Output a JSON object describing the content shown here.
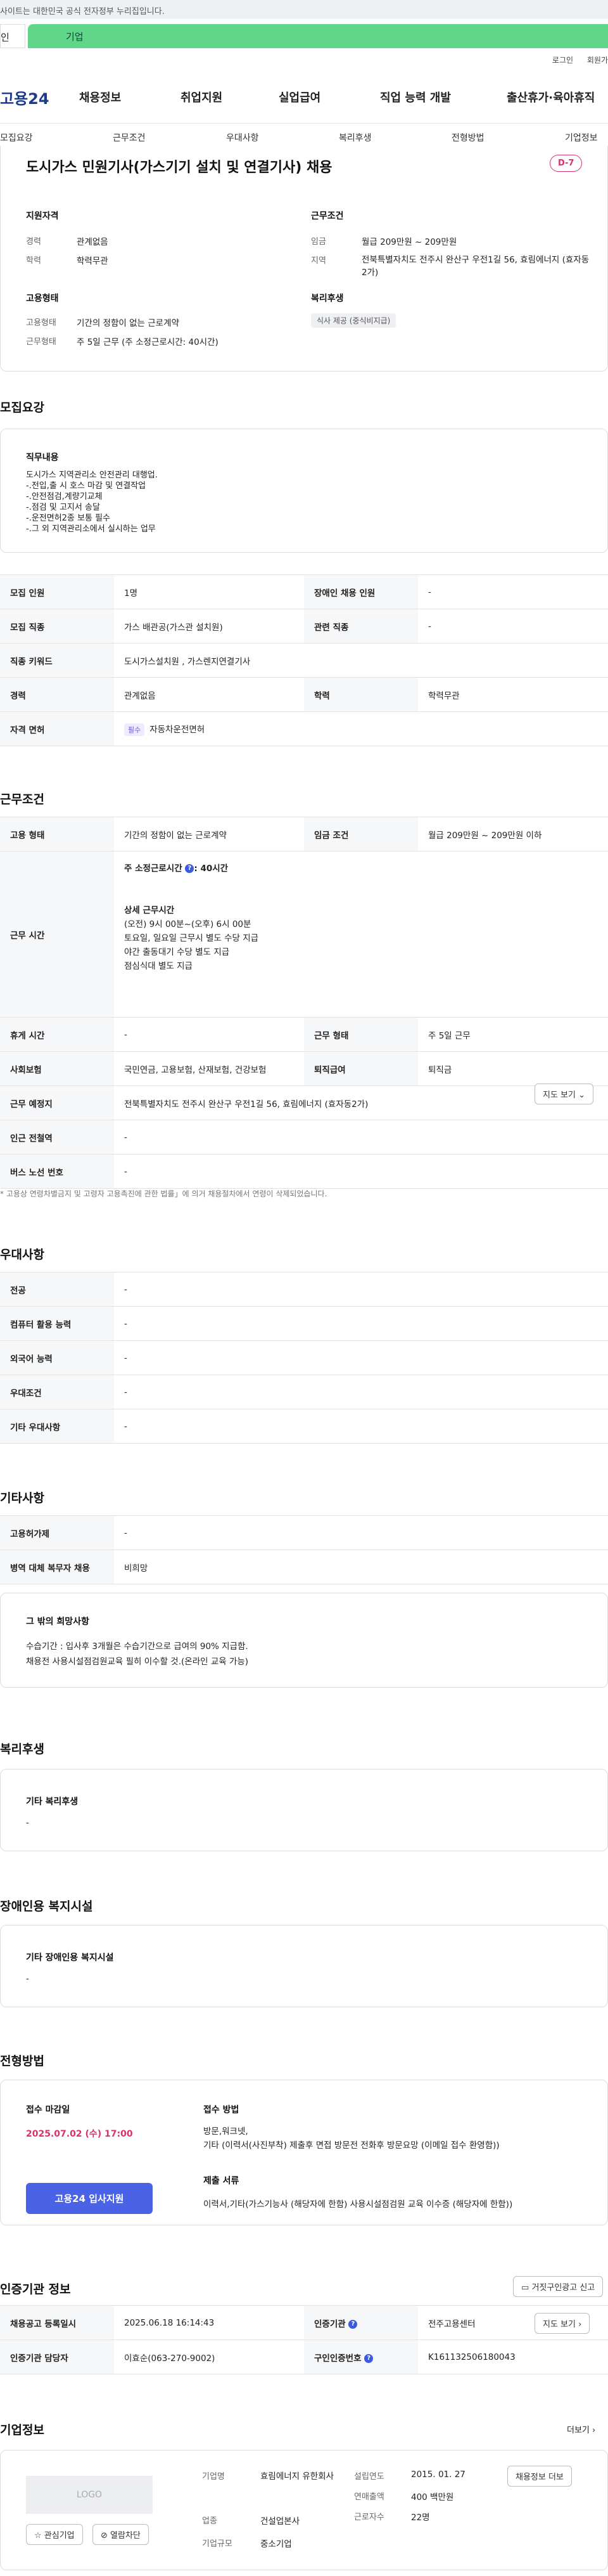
{
  "banner": {
    "text": "사이트는 대한민국 공식 전자정부 누리집입니다."
  },
  "topTabs": {
    "personal": "인",
    "company": "기업"
  },
  "util": {
    "login": "로그인",
    "join": "회원가"
  },
  "gnb": {
    "logo": "고용24",
    "menus": [
      "채용정보",
      "취업지원",
      "실업급여",
      "직업 능력 개발",
      "출산휴가·육아휴직"
    ]
  },
  "subnav": [
    "모집요강",
    "근무조건",
    "우대사항",
    "복리후생",
    "전형방법",
    "기업정보"
  ],
  "summary": {
    "title": "도시가스 민원기사(가스기기 설치 및 연결기사) 채용",
    "dday": "D-7",
    "qual_title": "지원자격",
    "career_label": "경력",
    "career_value": "관계없음",
    "edu_label": "학력",
    "edu_value": "학력무관",
    "cond_title": "근무조건",
    "wage_label": "임금",
    "wage_value": "월급 209만원 ~ 209만원",
    "region_label": "지역",
    "region_value": "전북특별자치도 전주시 완산구 우전1길 56, 효림에너지 (효자동2가)",
    "emp_title": "고용형태",
    "type_label": "고용형태",
    "type_value": "기간의 정함이 없는 근로계약",
    "work_label": "근무형태",
    "work_value": "주 5일 근무 (주 소정근로시간: 40시간)",
    "welfare_title": "복리후생",
    "welfare_badge": "식사 제공 (중식비지급)"
  },
  "recruit": {
    "title": "모집요강",
    "duty_title": "직무내용",
    "duty_lines": [
      "도시가스 지역관리소 안전관리 대행업.",
      "-.전입,출 시 호스 마감 및 연결작업",
      "-.안전점검,계량기교체",
      "-.점검 및 고지서 송달",
      "-.운전면허2종 보통 필수",
      "-.그 외 지역관리소에서 실시하는 업무"
    ],
    "rows": {
      "count_label": "모집 인원",
      "count_value": "1명",
      "disabled_label": "장애인 채용 인원",
      "disabled_value": "-",
      "job_label": "모집 직종",
      "job_value": "가스 배관공(가스관 설치원)",
      "related_label": "관련 직종",
      "related_value": "-",
      "kw_label": "직종 키워드",
      "kw_value": "도시가스설치원 , 가스렌지연결기사",
      "career_label": "경력",
      "career_value": "관계없음",
      "edu_label": "학력",
      "edu_value": "학력무관",
      "license_label": "자격 면허",
      "license_chip": "필수",
      "license_value": "자동차운전면허"
    }
  },
  "work": {
    "title": "근무조건",
    "type_label": "고용 형태",
    "type_value": "기간의 정함이 없는 근로계약",
    "wage_label": "임금 조건",
    "wage_value": "월급 209만원 ~ 209만원 이하",
    "hours_label": "근무 시간",
    "hours_main": "주 소정근로시간",
    "hours_main_value": ": 40시간",
    "hours_detail_title": "상세 근무시간",
    "hours_lines": [
      "(오전) 9시 00분~(오후) 6시 00분",
      "토요일, 일요일 근무시 별도 수당 지급",
      "야간 출동대기 수당 별도 지급",
      "점심식대 별도 지급"
    ],
    "rest_label": "휴게 시간",
    "rest_value": "-",
    "form_label": "근무 형태",
    "form_value": "주 5일 근무",
    "ins_label": "사회보험",
    "ins_value": "국민연금, 고용보험, 산재보험, 건강보험",
    "retire_label": "퇴직급여",
    "retire_value": "퇴직금",
    "place_label": "근무 예정지",
    "place_value": "전북특별자치도 전주시 완산구 우전1길 56, 효림에너지 (효자동2가)",
    "map_btn": "지도 보기",
    "station_label": "인근 전철역",
    "station_value": "-",
    "bus_label": "버스 노선 번호",
    "bus_value": "-",
    "note": "* 고용상 연령차별금지 및 고령자 고용촉진에 관한 법률」에 의거 채용절차에서 연령이 삭제되었습니다."
  },
  "pref": {
    "title": "우대사항",
    "major_label": "전공",
    "major_value": "-",
    "pc_label": "컴퓨터 활용 능력",
    "pc_value": "-",
    "lang_label": "외국어 능력",
    "lang_value": "-",
    "cond_label": "우대조건",
    "cond_value": "-",
    "etc_label": "기타 우대사항",
    "etc_value": "-"
  },
  "etc": {
    "title": "기타사항",
    "emp_label": "고용허가제",
    "emp_value": "-",
    "mil_label": "병역 대체 복무자 채용",
    "mil_value": "비희망",
    "hope_title": "그 밖의 희망사항",
    "hope_lines": [
      "수습기간 : 입사후 3개월은 수습기간으로 급여의 90% 지급함.",
      "채용전 사용시설점검원교육 필히 이수할 것.(온라인 교육 가능)"
    ]
  },
  "welfare": {
    "title": "복리후생",
    "sub": "기타 복리후생",
    "value": "-"
  },
  "disability": {
    "title": "장애인용 복지시설",
    "sub": "기타 장애인용 복지시설",
    "value": "-"
  },
  "process": {
    "title": "전형방법",
    "deadline_label": "접수 마감일",
    "deadline_value": "2025.07.02 (수) 17:00",
    "apply_btn": "고용24 입사지원",
    "method_label": "접수 방법",
    "method_lines": [
      "방문,워크넷,",
      "기타 (이력서(사진부착) 제출후 면접 방문전 전화후 방문요망 (이메일 접수 환영함))"
    ],
    "docs_label": "제출 서류",
    "docs_value": "이력서,기타(가스기능사 (해당자에 한함) 사용시설점검원 교육 이수증 (해당자에 한함))"
  },
  "agency": {
    "title": "인증기관 정보",
    "report_btn": "거짓구인광고 신고",
    "reg_label": "채용공고 등록일시",
    "reg_value": "2025.06.18 16:14:43",
    "org_label": "인증기관",
    "org_value": "전주고용센터",
    "map_btn": "지도 보기",
    "mgr_label": "인증기관 담당자",
    "mgr_value": "이효순(063-270-9002)",
    "no_label": "구인인증번호",
    "no_value": "K161132506180043"
  },
  "company": {
    "title": "기업정보",
    "more": "더보기",
    "logo_text": "LOGO",
    "fav_btn": "관심기업",
    "block_btn": "열람차단",
    "name_label": "기업명",
    "name_value": "효림에너지 유한회사",
    "industry_label": "업종",
    "industry_value": "건설업본사",
    "size_label": "기업규모",
    "size_value": "중소기업",
    "est_label": "설립연도",
    "est_value": "2015. 01. 27",
    "sales_label": "연매출액",
    "sales_value": "400 백만원",
    "staff_label": "근로자수",
    "staff_value": "22명",
    "jobs_btn": "채용정보 더보"
  }
}
